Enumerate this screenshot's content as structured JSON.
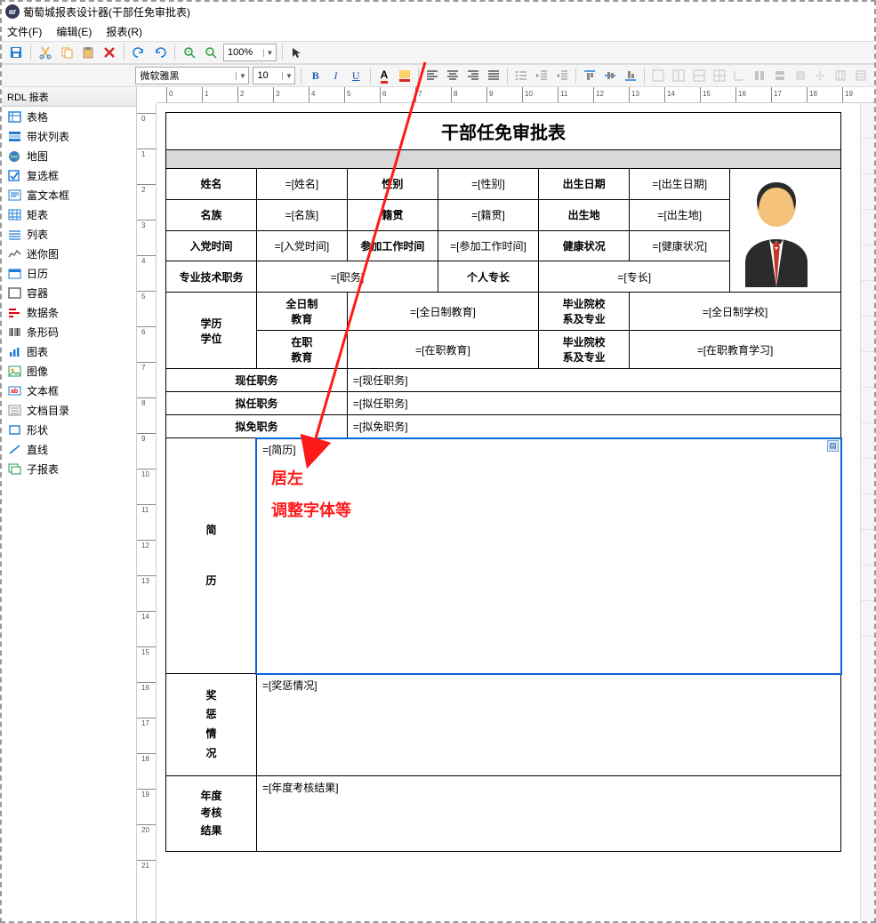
{
  "window": {
    "title": "葡萄城报表设计器(干部任免审批表)"
  },
  "menu": {
    "file": "文件(F)",
    "edit": "编辑(E)",
    "report": "报表(R)"
  },
  "toolbar1": {
    "zoom": "100%"
  },
  "toolbar2": {
    "font": "微软雅黑",
    "size": "10"
  },
  "sidebar": {
    "header": "RDL 报表",
    "items": [
      {
        "label": "表格",
        "icon": "table-icon",
        "color": "#1e7bd6"
      },
      {
        "label": "带状列表",
        "icon": "banded-list-icon",
        "color": "#1e7bd6"
      },
      {
        "label": "地图",
        "icon": "map-icon",
        "color": "#1b6db3"
      },
      {
        "label": "复选框",
        "icon": "checkbox-icon",
        "color": "#1e7bd6"
      },
      {
        "label": "富文本框",
        "icon": "richtext-icon",
        "color": "#1e7bd6"
      },
      {
        "label": "矩表",
        "icon": "matrix-icon",
        "color": "#1e7bd6"
      },
      {
        "label": "列表",
        "icon": "list-icon",
        "color": "#1e7bd6"
      },
      {
        "label": "迷你图",
        "icon": "sparkline-icon",
        "color": "#555"
      },
      {
        "label": "日历",
        "icon": "calendar-icon",
        "color": "#1e7bd6"
      },
      {
        "label": "容器",
        "icon": "container-icon",
        "color": "#555"
      },
      {
        "label": "数据条",
        "icon": "databar-icon",
        "color": "#d01"
      },
      {
        "label": "条形码",
        "icon": "barcode-icon",
        "color": "#333"
      },
      {
        "label": "图表",
        "icon": "chart-icon",
        "color": "#1e7bd6"
      },
      {
        "label": "图像",
        "icon": "image-icon",
        "color": "#1b9e4a"
      },
      {
        "label": "文本框",
        "icon": "textbox-icon",
        "color": "#1e7bd6"
      },
      {
        "label": "文档目录",
        "icon": "toc-icon",
        "color": "#555"
      },
      {
        "label": "形状",
        "icon": "shape-icon",
        "color": "#1e7bd6"
      },
      {
        "label": "直线",
        "icon": "line-icon",
        "color": "#1e7bd6"
      },
      {
        "label": "子报表",
        "icon": "subreport-icon",
        "color": "#1b9e4a"
      }
    ]
  },
  "ruler_h": [
    "0",
    "1",
    "2",
    "3",
    "4",
    "5",
    "6",
    "7",
    "8",
    "9",
    "10",
    "11",
    "12",
    "13",
    "14",
    "15",
    "16",
    "17",
    "18",
    "19"
  ],
  "ruler_v": [
    "0",
    "1",
    "2",
    "3",
    "4",
    "5",
    "6",
    "7",
    "8",
    "9",
    "10",
    "11",
    "12",
    "13",
    "14",
    "15",
    "16",
    "17",
    "18",
    "19",
    "20",
    "21"
  ],
  "form": {
    "title": "干部任免审批表",
    "r1": {
      "c1": "姓名",
      "v1": "=[姓名]",
      "c2": "性别",
      "v2": "=[性别]",
      "c3": "出生日期",
      "v3": "=[出生日期]"
    },
    "r2": {
      "c1": "名族",
      "v1": "=[名族]",
      "c2": "籍贯",
      "v2": "=[籍贯]",
      "c3": "出生地",
      "v3": "=[出生地]"
    },
    "r3": {
      "c1": "入党时间",
      "v1": "=[入党时间]",
      "c2": "参加工作时间",
      "v2": "=[参加工作时间]",
      "c3": "健康状况",
      "v3": "=[健康状况]"
    },
    "r4": {
      "c1": "专业技术职务",
      "v1": "=[职务]",
      "c2": "个人专长",
      "v2": "=[专长]"
    },
    "edu": {
      "label": "学历\n学位",
      "full_label": "全日制\n教育",
      "full_val": "=[全日制教育]",
      "full_school_label": "毕业院校\n系及专业",
      "full_school_val": "=[全日制学校]",
      "job_label": "在职\n教育",
      "job_val": "=[在职教育]",
      "job_school_label": "毕业院校\n系及专业",
      "job_school_val": "=[在职教育学习]"
    },
    "pos": {
      "now_label": "现任职务",
      "now_val": "=[现任职务]",
      "plan_label": "拟任职务",
      "plan_val": "=[拟任职务]",
      "remove_label": "拟免职务",
      "remove_val": "=[拟免职务]"
    },
    "resume": {
      "label": "简\n\n历",
      "val": "=[简历]"
    },
    "reward": {
      "label": "奖\n惩\n情\n况",
      "val": "=[奖惩情况]"
    },
    "annual": {
      "label": "年度\n考核\n结果",
      "val": "=[年度考核结果]"
    },
    "anno_line1": "居左",
    "anno_line2": "调整字体等"
  }
}
